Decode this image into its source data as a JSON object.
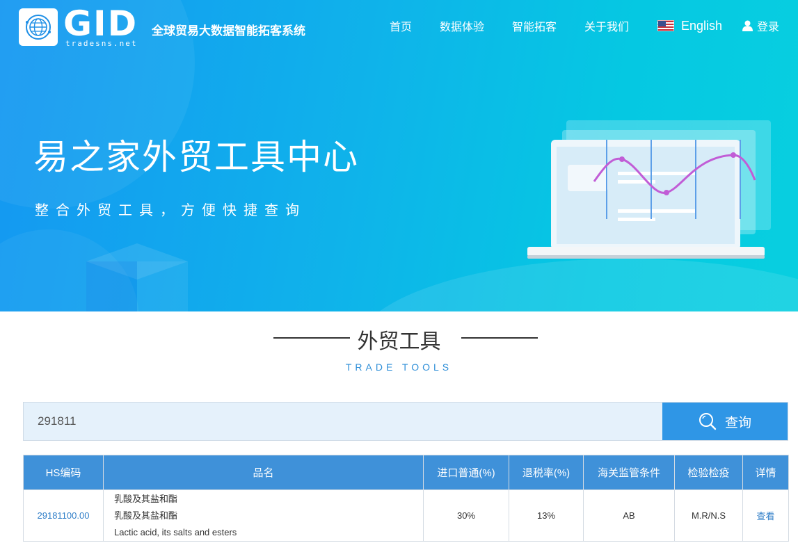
{
  "brand": {
    "logo_text": "GID",
    "domain": "tradesns.net",
    "slogan": "全球贸易大数据智能拓客系统"
  },
  "nav": {
    "home": "首页",
    "data_experience": "数据体验",
    "smart_prospecting": "智能拓客",
    "about": "关于我们",
    "language": "English",
    "login": "登录"
  },
  "hero": {
    "title": "易之家外贸工具中心",
    "subtitle": "整合外贸工具，方便快捷查询"
  },
  "section": {
    "title": "外贸工具",
    "subtitle": "TRADE TOOLS"
  },
  "search": {
    "value": "291811",
    "button_label": "查询"
  },
  "table": {
    "headers": [
      "HS编码",
      "品名",
      "进口普通(%)",
      "退税率(%)",
      "海关监管条件",
      "检验检疫",
      "详情"
    ],
    "rows": [
      {
        "hs_code": "29181100.00",
        "name_lines": [
          "乳酸及其盐和酯",
          "乳酸及其盐和酯",
          "Lactic acid, its salts and esters"
        ],
        "import_general": "30%",
        "tax_refund": "13%",
        "customs_condition": "AB",
        "inspection": "M.R/N.S",
        "detail": "查看"
      }
    ]
  },
  "colors": {
    "hero_gradient_start": "#1597f2",
    "hero_gradient_end": "#08cfe0",
    "accent_blue": "#2f96e6",
    "table_header": "#3f91d9",
    "link": "#2f7ec8"
  },
  "icons": [
    "globe-logo-icon",
    "us-flag-icon",
    "user-icon",
    "search-icon"
  ]
}
